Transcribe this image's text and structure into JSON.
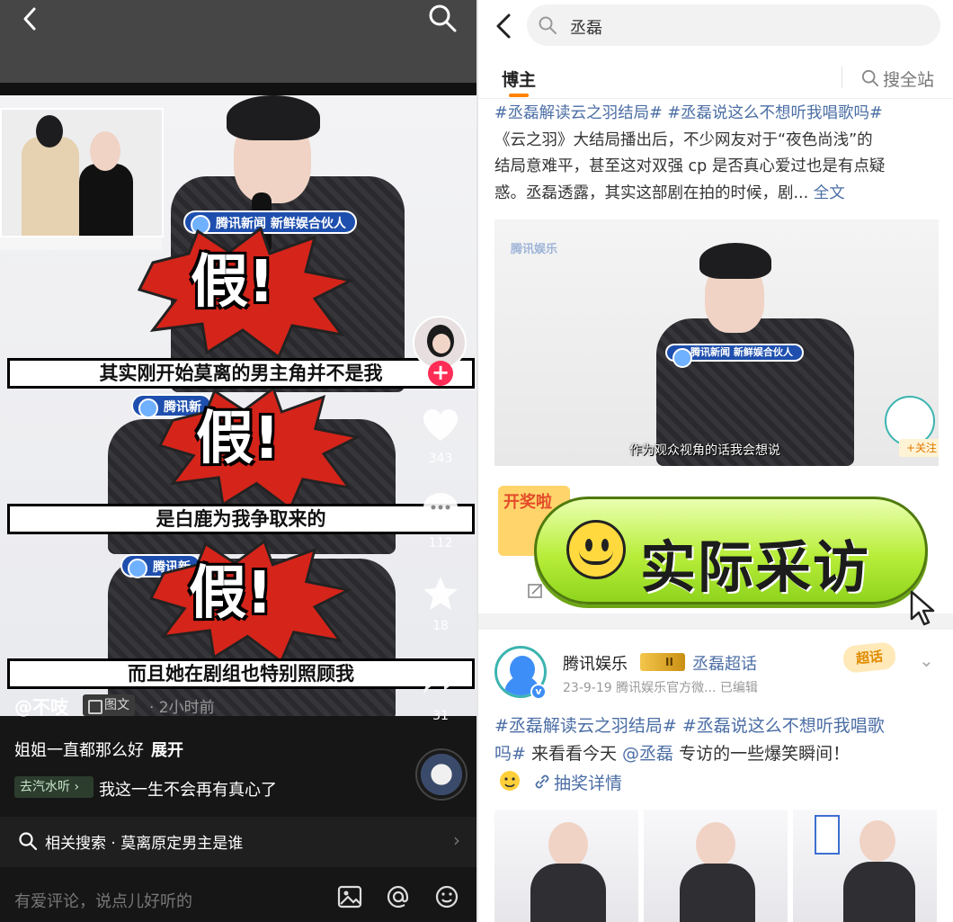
{
  "left": {
    "photo_inset_tag": "腾讯新闻",
    "news_tag_text": "腾讯新闻  新鲜娱合伙人",
    "news_tag_short": "腾讯新",
    "burst_text": "假!",
    "captions": [
      "其实刚开始莫离的男主角并不是我",
      "是白鹿为我争取来的",
      "而且她在剧组也特别照顾我"
    ],
    "counts": {
      "likes": "343",
      "comments": "112",
      "favorites": "18",
      "shares": "31"
    },
    "author": "@不吱",
    "type_badge": "图文",
    "time": "· 2小时前",
    "description": "姐姐一直都那么好",
    "expand_label": "展开",
    "music_chip": "去汽水听 ›",
    "music_title": "我这一生不会再有真心了",
    "related_label": "相关搜索 · 莫离原定男主是谁",
    "comment_placeholder": "有爱评论，说点儿好听的",
    "colors": {
      "like_red": "#ff2d55",
      "burst_red": "#d5241a"
    }
  },
  "right": {
    "search_query": "丞磊",
    "tab_bozhu": "博主",
    "tab_search_all": "搜全站",
    "post1": {
      "tags_line": "#丞磊解读云之羽结局# #丞磊说这么不想听我唱歌吗#",
      "body_1": "《云之羽》大结局播出后，不少网友对于“夜色尚浅”的",
      "body_2": "结局意难平，甚至这对双强 cp 是否真心爱过也是有点疑",
      "body_3": "惑。丞磊透露，其实这部剧在拍的时候，剧... ",
      "full_text": "全文",
      "video_logo": "腾讯娱乐",
      "video_tag": "腾讯新闻  新鲜娱合伙人",
      "video_subtitle": "作为观众视角的话我会想说",
      "follow_label": "+关注",
      "lottery_card": "开奖啦"
    },
    "overlay_text": "实际采访",
    "post2": {
      "name": "腾讯娱乐",
      "level_badge": "II",
      "chaohua": "丞磊超话",
      "meta": "23-9-19  腾讯娱乐官方微...  已编辑",
      "badge": "超话",
      "text_line1": "#丞磊解读云之羽结局# #丞磊说这么不想听我唱歌",
      "text_line2a": "吗#",
      "text_line2b": " 来看看今天 ",
      "mention": "@丞磊",
      "text_line2c": " 专访的一些爆笑瞬间！",
      "lottery_detail": "抽奖详情"
    },
    "colors": {
      "link_blue": "#4b6ea5",
      "tab_orange": "#ff8200",
      "pill_green": "#b8ee3a"
    }
  }
}
